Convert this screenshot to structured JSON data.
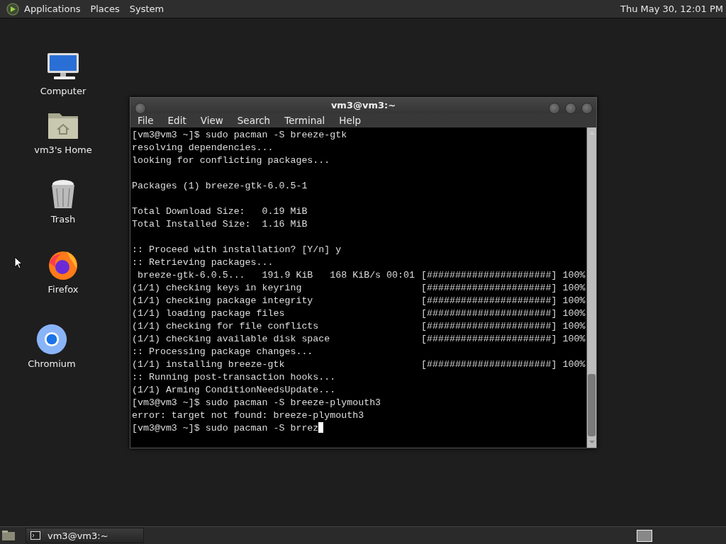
{
  "top_panel": {
    "menus": [
      "Applications",
      "Places",
      "System"
    ],
    "clock": "Thu May 30, 12:01 PM"
  },
  "desktop_icons": [
    {
      "kind": "computer",
      "label": "Computer"
    },
    {
      "kind": "home",
      "label": "vm3's Home"
    },
    {
      "kind": "trash",
      "label": "Trash"
    },
    {
      "kind": "firefox",
      "label": "Firefox"
    },
    {
      "kind": "chromium",
      "label": "Chromium"
    }
  ],
  "window": {
    "title": "vm3@vm3:~",
    "menu": [
      "File",
      "Edit",
      "View",
      "Search",
      "Terminal",
      "Help"
    ],
    "terminal": {
      "cursor": true,
      "blocks": [
        [
          {
            "text": "[vm3@vm3 ~]$ sudo pacman -S breeze-gtk"
          },
          {
            "text": "resolving dependencies..."
          },
          {
            "text": "looking for conflicting packages..."
          }
        ],
        [
          {
            "text": "Packages (1) breeze-gtk-6.0.5-1"
          }
        ],
        [
          {
            "text": "Total Download Size:   0.19 MiB"
          },
          {
            "text": "Total Installed Size:  1.16 MiB"
          }
        ],
        [
          {
            "text": ":: Proceed with installation? [Y/n] y"
          },
          {
            "text": ":: Retrieving packages..."
          },
          {
            "text": " breeze-gtk-6.0.5...   191.9 KiB   168 KiB/s 00:01",
            "progress": "[######################] 100%"
          },
          {
            "text": "(1/1) checking keys in keyring",
            "progress": "[######################] 100%"
          },
          {
            "text": "(1/1) checking package integrity",
            "progress": "[######################] 100%"
          },
          {
            "text": "(1/1) loading package files",
            "progress": "[######################] 100%"
          },
          {
            "text": "(1/1) checking for file conflicts",
            "progress": "[######################] 100%"
          },
          {
            "text": "(1/1) checking available disk space",
            "progress": "[######################] 100%"
          },
          {
            "text": ":: Processing package changes..."
          },
          {
            "text": "(1/1) installing breeze-gtk",
            "progress": "[######################] 100%"
          },
          {
            "text": ":: Running post-transaction hooks..."
          },
          {
            "text": "(1/1) Arming ConditionNeedsUpdate..."
          },
          {
            "text": "[vm3@vm3 ~]$ sudo pacman -S breeze-plymouth3"
          },
          {
            "text": "error: target not found: breeze-plymouth3"
          },
          {
            "text": "[vm3@vm3 ~]$ sudo pacman -S brrez"
          }
        ]
      ]
    }
  },
  "taskbar": {
    "tasks": [
      {
        "label": "vm3@vm3:~",
        "selected": false
      }
    ]
  }
}
